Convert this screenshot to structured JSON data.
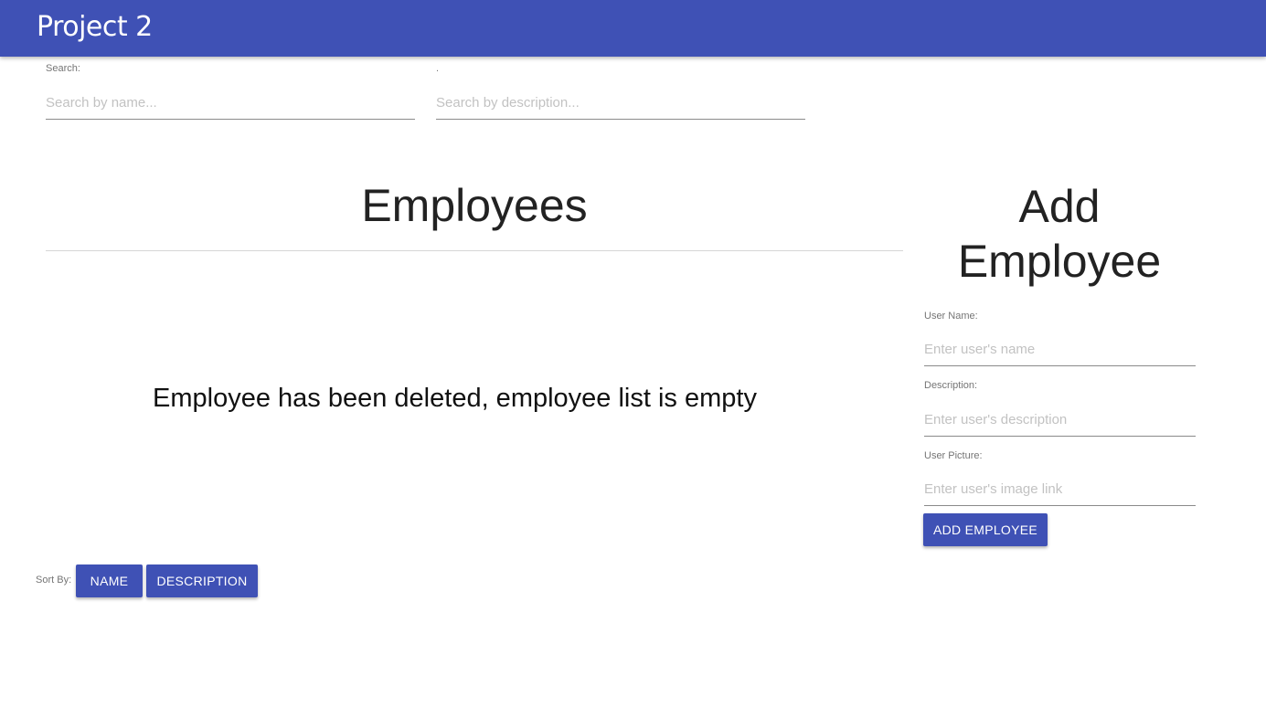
{
  "app": {
    "title": "Project 2"
  },
  "search": {
    "name_label": "Search:",
    "name_placeholder": "Search by name...",
    "name_value": "",
    "description_label": ".",
    "description_placeholder": "Search by description...",
    "description_value": ""
  },
  "employees": {
    "heading": "Employees",
    "empty_message": "Employee has been deleted, employee list is empty"
  },
  "add_employee": {
    "heading_line1": "Add",
    "heading_line2": "Employee",
    "user_name_label": "User Name:",
    "user_name_placeholder": "Enter user's name",
    "description_label": "Description:",
    "description_placeholder": "Enter user's description",
    "picture_label": "User Picture:",
    "picture_placeholder": "Enter user's image link",
    "submit_label": "ADD EMPLOYEE"
  },
  "sort": {
    "label": "Sort By:",
    "name_button": "NAME",
    "description_button": "DESCRIPTION"
  },
  "colors": {
    "primary": "#3f51b5",
    "background": "#ffffff"
  }
}
